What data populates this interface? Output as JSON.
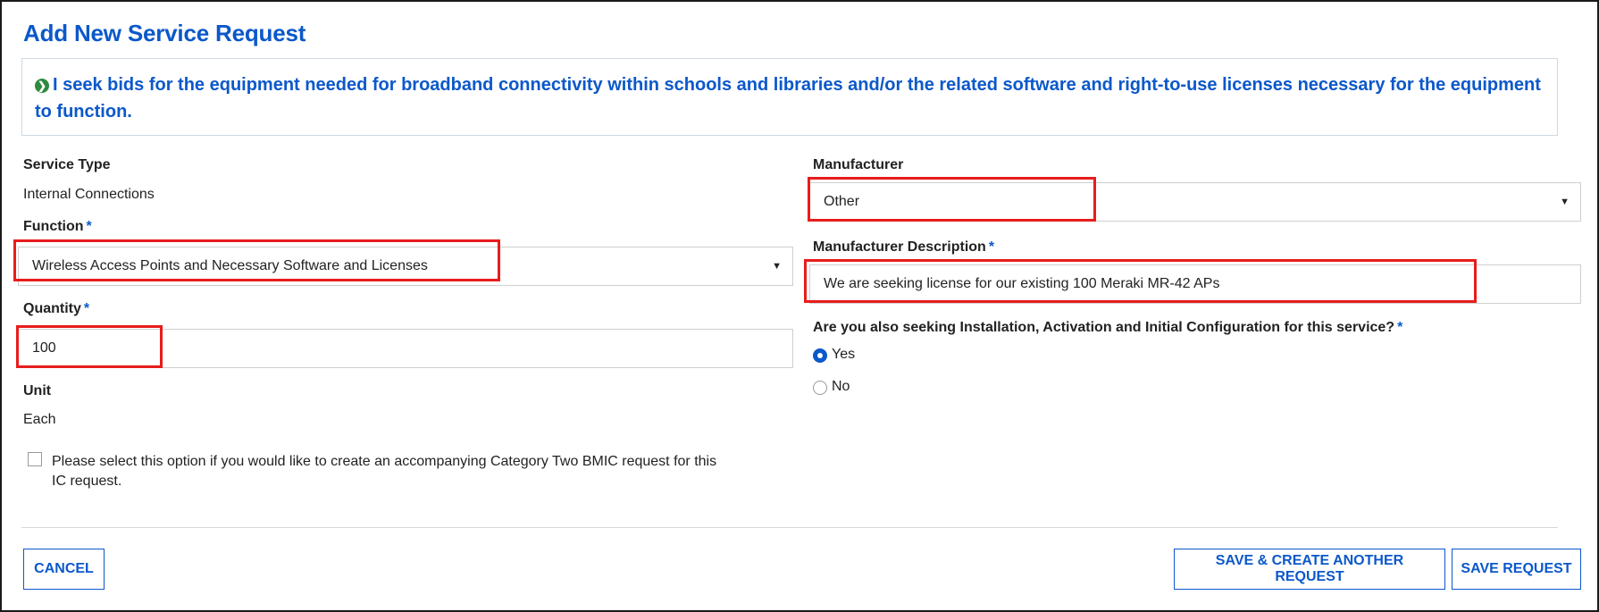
{
  "page_title": "Add New Service Request",
  "info": {
    "icon": "arrow-circle-right-icon",
    "text": "I seek bids for the equipment needed for broadband connectivity within schools and libraries and/or the related software and right-to-use licenses necessary for the equipment to function."
  },
  "service_type": {
    "label": "Service Type",
    "value": "Internal Connections"
  },
  "function": {
    "label": "Function",
    "required_mark": "*",
    "value": "Wireless Access Points and Necessary Software and Licenses"
  },
  "quantity": {
    "label": "Quantity",
    "required_mark": "*",
    "value": "100"
  },
  "unit": {
    "label": "Unit",
    "value": "Each"
  },
  "bmic_option": {
    "line1": "Please select this option if you would like to create an accompanying Category Two BMIC request for this",
    "line2": "IC request.",
    "checked": false
  },
  "manufacturer": {
    "label": "Manufacturer",
    "value": "Other"
  },
  "manufacturer_description": {
    "label": "Manufacturer Description",
    "required_mark": "*",
    "value": "We are seeking license for our existing 100 Meraki MR-42 APs"
  },
  "installation": {
    "question": "Are you also seeking Installation, Activation and Initial Configuration for this service?",
    "required_mark": "*",
    "options": [
      {
        "label": "Yes",
        "selected": true
      },
      {
        "label": "No",
        "selected": false
      }
    ]
  },
  "buttons": {
    "cancel": "CANCEL",
    "save_create_another": "SAVE & CREATE ANOTHER REQUEST",
    "save": "SAVE REQUEST"
  },
  "colors": {
    "accent": "#0b58ca",
    "highlight": "#e81c1c",
    "info_icon": "#2e8b3e"
  }
}
